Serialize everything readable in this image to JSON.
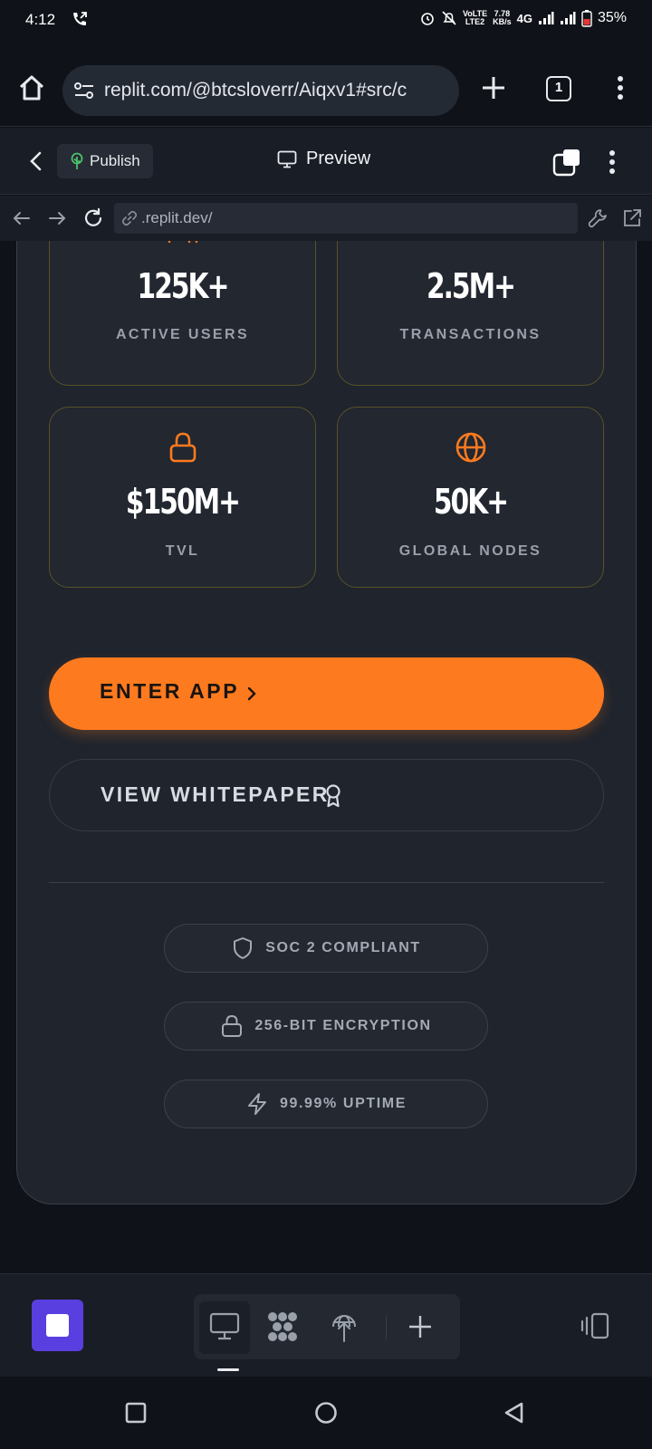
{
  "status_bar": {
    "time": "4:12",
    "net_line1": "VoLTE",
    "net_line2": "LTE2",
    "speed_value": "7.78",
    "speed_unit": "KB/s",
    "network": "4G",
    "battery": "35%"
  },
  "browser": {
    "url": "replit.com/@btcsloverr/Aiqxv1#src/c",
    "tab_count": "1"
  },
  "replit_header": {
    "publish_label": "Publish",
    "preview_label": "Preview"
  },
  "webview": {
    "url": ".replit.dev/"
  },
  "stats": [
    {
      "icon": "users-icon",
      "value": "125K+",
      "label": "ACTIVE USERS"
    },
    {
      "icon": "trending-up-icon",
      "value": "2.5M+",
      "label": "TRANSACTIONS"
    },
    {
      "icon": "lock-icon",
      "value": "$150M+",
      "label": "TVL"
    },
    {
      "icon": "globe-icon",
      "value": "50K+",
      "label": "GLOBAL NODES"
    }
  ],
  "actions": {
    "enter_app_label": "ENTER APP",
    "whitepaper_label": "VIEW WHITEPAPER"
  },
  "badges": [
    {
      "icon": "shield-icon",
      "text": "SOC 2 COMPLIANT"
    },
    {
      "icon": "lock-icon",
      "text": "256-BIT ENCRYPTION"
    },
    {
      "icon": "zap-icon",
      "text": "99.99% UPTIME"
    }
  ],
  "colors": {
    "accent": "#fd7a1f",
    "card_bg": "#1f242d",
    "stat_border": "#5a5228",
    "page_bg": "#0f1218",
    "replit_purple": "#5a3fe0"
  }
}
